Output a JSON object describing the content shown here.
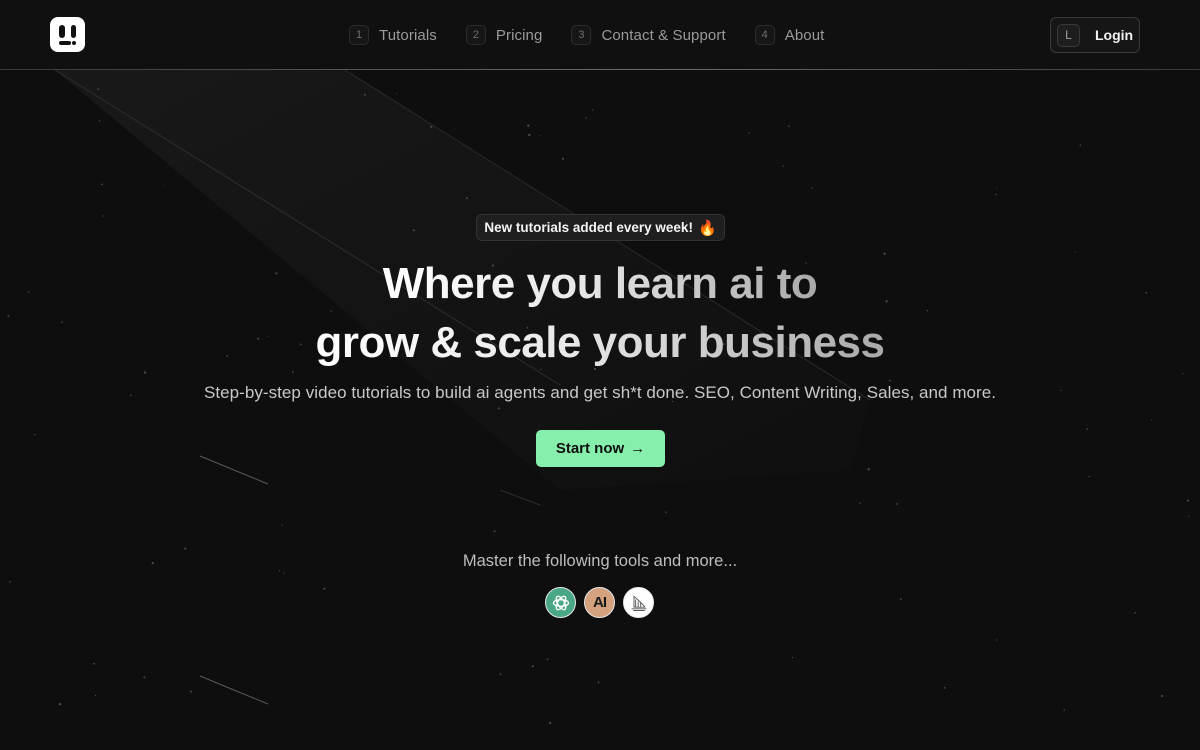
{
  "header": {
    "logo_icon": "brand-logo-icon",
    "nav": [
      {
        "key": "1",
        "label": "Tutorials"
      },
      {
        "key": "2",
        "label": "Pricing"
      },
      {
        "key": "3",
        "label": "Contact & Support"
      },
      {
        "key": "4",
        "label": "About"
      }
    ],
    "login": {
      "key": "L",
      "label": "Login"
    }
  },
  "hero": {
    "badge": {
      "text": "New tutorials added every week!",
      "emoji": "🔥"
    },
    "headline_line1": "Where you learn ai to",
    "headline_line2": "grow & scale your business",
    "subtitle": "Step-by-step video tutorials to build ai agents and get sh*t done. SEO, Content Writing, Sales, and more.",
    "cta": {
      "label": "Start now",
      "arrow": "→"
    }
  },
  "tools": {
    "label": "Master the following tools and more...",
    "items": [
      {
        "name": "openai-icon",
        "color": "#4aa886"
      },
      {
        "name": "anthropic-icon",
        "text": "AI",
        "color": "#d4a27f"
      },
      {
        "name": "midjourney-icon",
        "color": "#ffffff"
      }
    ]
  },
  "colors": {
    "background": "#0e0e0e",
    "accent": "#86efac"
  }
}
